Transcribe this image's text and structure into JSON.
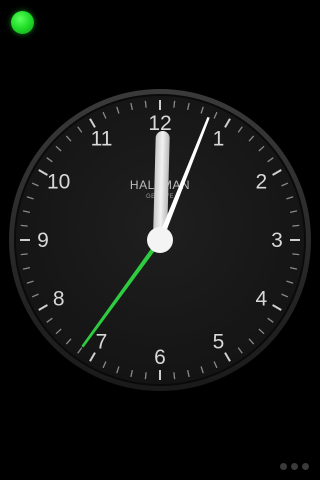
{
  "app": {
    "name": "Clock"
  },
  "clock": {
    "brand": "HALLMAN",
    "brand_sub": "GENEVE",
    "numerals": [
      "12",
      "1",
      "2",
      "3",
      "4",
      "5",
      "6",
      "7",
      "8",
      "9",
      "10",
      "11"
    ],
    "time": {
      "hour": 12,
      "minute": 3,
      "second": 36
    },
    "colors": {
      "face": "#1a1a1a",
      "bezel": "#2a2a2a",
      "numeral": "#d8d8d8",
      "hour_hand": "#dcdcdc",
      "minute_hand": "#ffffff",
      "second_hand": "#2ecc40",
      "status_dot": "#22e02a"
    }
  },
  "status": {
    "indicator_icon": "green-status-dot"
  },
  "pager": {
    "pages": 3
  }
}
